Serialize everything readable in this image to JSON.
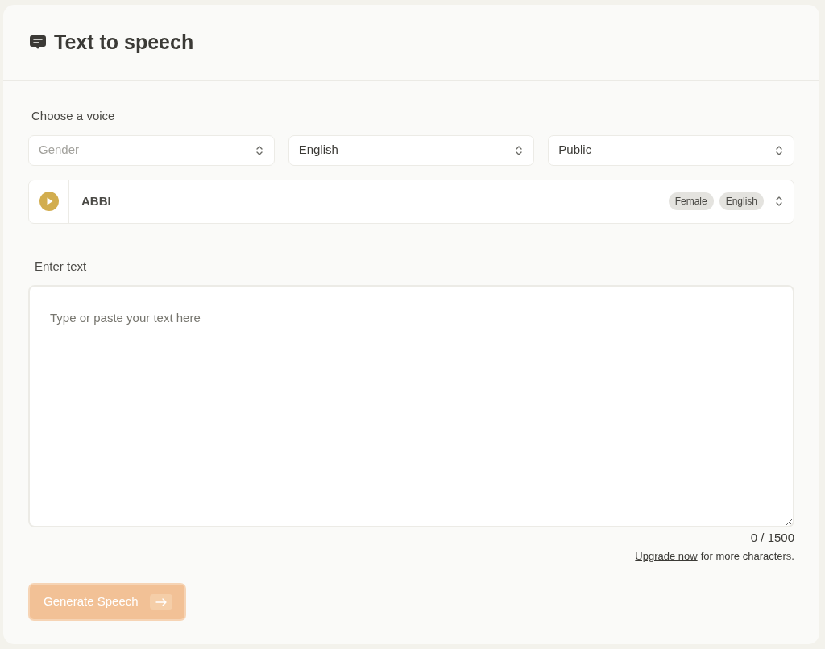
{
  "header": {
    "title": "Text to speech"
  },
  "voice_section": {
    "label": "Choose a voice",
    "selects": [
      {
        "placeholder": "Gender"
      },
      {
        "value": "English"
      },
      {
        "value": "Public"
      }
    ],
    "voice": {
      "name": "ABBI",
      "tags": [
        "Female",
        "English"
      ]
    }
  },
  "text_section": {
    "label": "Enter text",
    "placeholder": "Type or paste your text here",
    "counter": "0 / 1500",
    "upgrade_link": "Upgrade now",
    "upgrade_rest": "for more characters."
  },
  "generate_button": {
    "label": "Generate Speech",
    "disabled": true
  }
}
